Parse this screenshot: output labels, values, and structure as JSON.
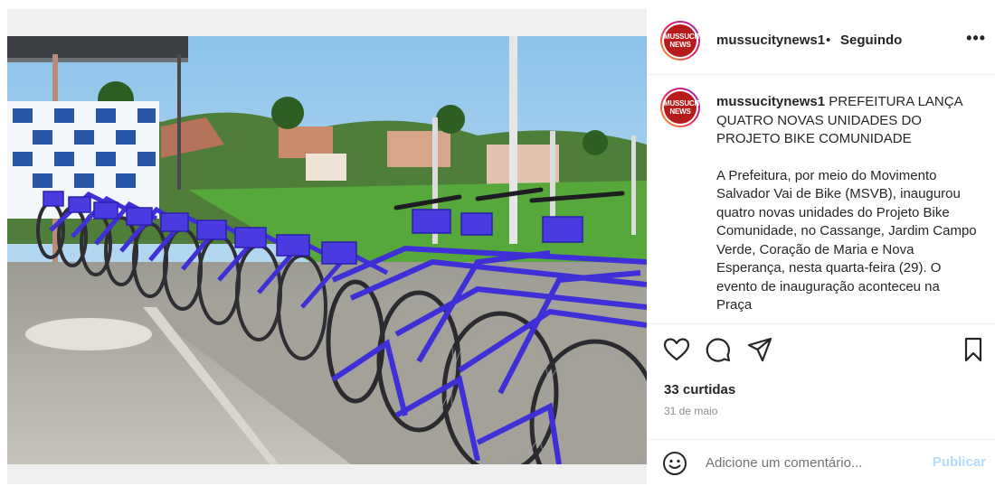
{
  "post": {
    "author": "mussucitynews1",
    "separator": "•",
    "follow_status": "Seguindo",
    "more_icon": "more-horizontal-icon",
    "avatar_text_top": "MUSSUCITY",
    "avatar_text_bottom": "NEWS",
    "image_alt": "Fileira de bicicletas azuis do Projeto Bike Comunidade"
  },
  "caption": {
    "author": "mussucitynews1",
    "headline": "PREFEITURA LANÇA QUATRO NOVAS UNIDADES DO PROJETO BIKE COMUNIDADE",
    "body": "A Prefeitura, por meio do Movimento Salvador Vai de Bike (MSVB), inaugurou quatro novas unidades do Projeto Bike Comunidade, no Cassange, Jardim Campo Verde, Coração de Maria e Nova Esperança, nesta quarta-feira (29). O evento de inauguração aconteceu na Praça"
  },
  "actions": {
    "icons": [
      "heart-icon",
      "comment-icon",
      "share-icon",
      "bookmark-icon"
    ],
    "likes": "33 curtidas",
    "date": "31 de maio"
  },
  "comment": {
    "placeholder": "Adicione um comentário...",
    "publish_label": "Publicar",
    "emoji_icon": "emoji-icon"
  },
  "colors": {
    "bike_blue": "#3f2fd6",
    "publish_disabled": "#b3dbff",
    "avatar_red": "#b71c1c"
  }
}
